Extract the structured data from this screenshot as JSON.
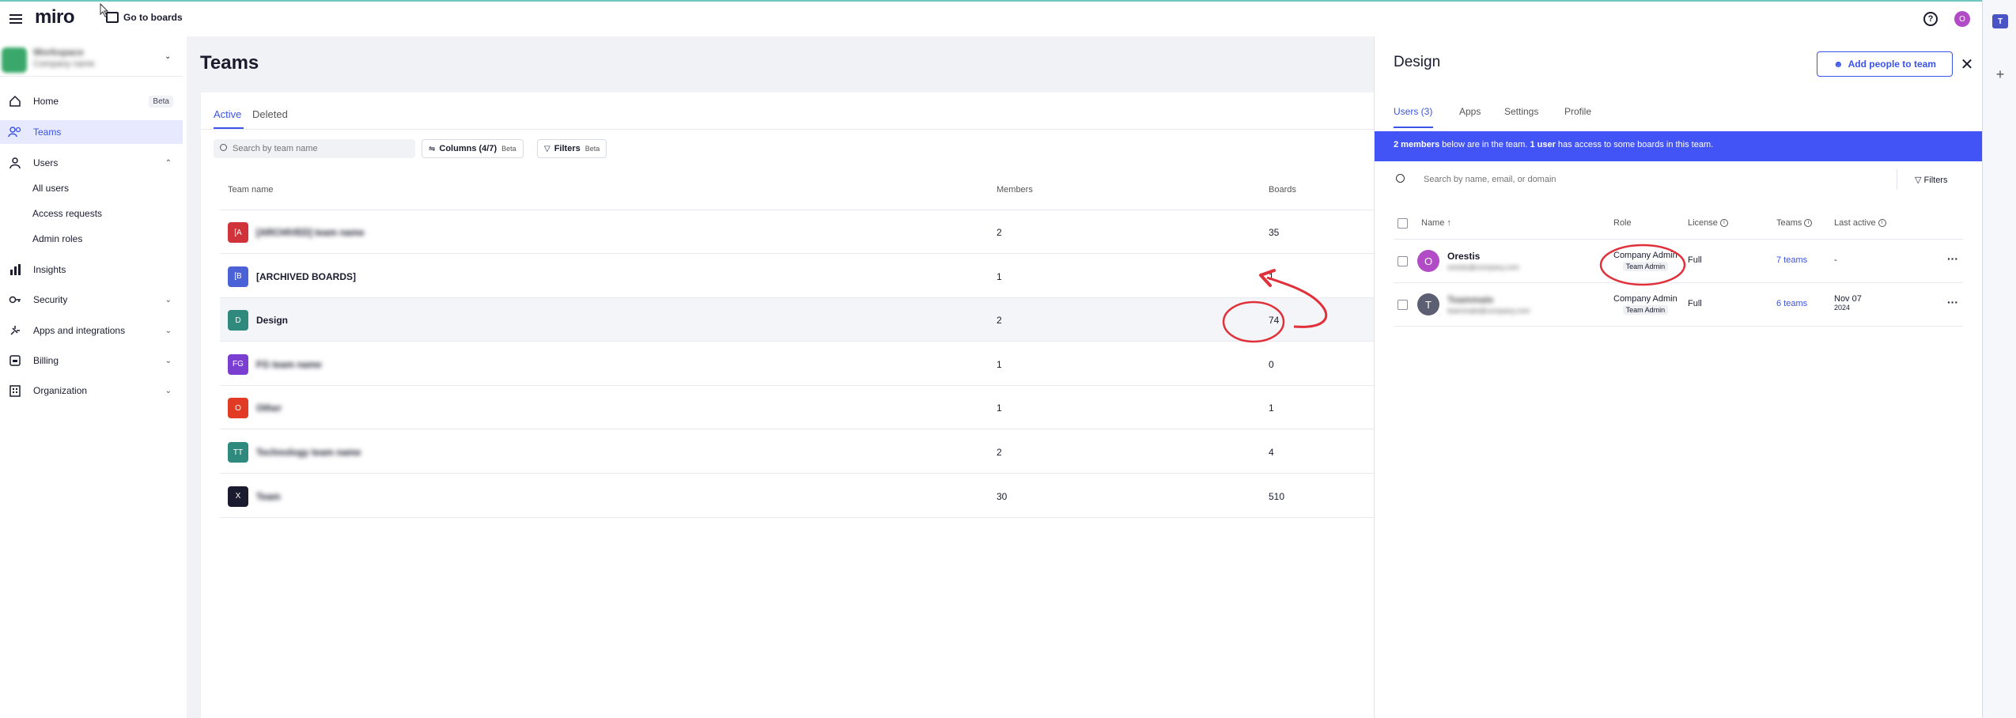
{
  "app": {
    "logo": "miro",
    "go_to_boards": "Go to boards",
    "user_initial": "O"
  },
  "sidebar": {
    "org_name": "Workspace",
    "org_sub": "Company name",
    "items": [
      {
        "label": "Home",
        "badge": "Beta"
      },
      {
        "label": "Teams"
      },
      {
        "label": "Users"
      },
      {
        "label": "Insights"
      },
      {
        "label": "Security"
      },
      {
        "label": "Apps and integrations"
      },
      {
        "label": "Billing"
      },
      {
        "label": "Organization"
      }
    ],
    "users_sub": [
      "All users",
      "Access requests",
      "Admin roles"
    ]
  },
  "main": {
    "title": "Teams",
    "tabs": [
      "Active",
      "Deleted"
    ],
    "search_placeholder": "Search by team name",
    "columns_label": "Columns (4/7)",
    "columns_badge": "Beta",
    "filters_label": "Filters",
    "filters_badge": "Beta",
    "headers": {
      "team": "Team name",
      "members": "Members",
      "boards": "Boards"
    },
    "rows": [
      {
        "initials": "[A",
        "name": "[ARCHIVED] team name",
        "members": "2",
        "boards": "35",
        "color": "#d0333a",
        "blurred": true
      },
      {
        "initials": "[B",
        "name": "[ARCHIVED BOARDS]",
        "members": "1",
        "boards": "1",
        "color": "#4b62d6",
        "blurred": false
      },
      {
        "initials": "D",
        "name": "Design",
        "members": "2",
        "boards": "74",
        "color": "#2f8a7d",
        "blurred": false
      },
      {
        "initials": "FG",
        "name": "FG team name",
        "members": "1",
        "boards": "0",
        "color": "#7a3fd1",
        "blurred": true
      },
      {
        "initials": "O",
        "name": "Other",
        "members": "1",
        "boards": "1",
        "color": "#e13a25",
        "blurred": true
      },
      {
        "initials": "TT",
        "name": "Technology team name",
        "members": "2",
        "boards": "4",
        "color": "#2f8a7d",
        "blurred": true
      },
      {
        "initials": "X",
        "name": "Team",
        "members": "30",
        "boards": "510",
        "color": "#1a1b2e",
        "blurred": true
      }
    ]
  },
  "panel": {
    "title": "Design",
    "add_people": "Add people to team",
    "tabs": [
      "Users (3)",
      "Apps",
      "Settings",
      "Profile"
    ],
    "banner_bold1": "2 members",
    "banner_mid": " below are in the team. ",
    "banner_bold2": "1 user",
    "banner_end": " has access to some boards in this team.",
    "search_placeholder": "Search by name, email, or domain",
    "filters_label": "Filters",
    "headers": {
      "name": "Name ↑",
      "role": "Role",
      "license": "License",
      "teams": "Teams",
      "last_active": "Last active"
    },
    "users": [
      {
        "initial": "O",
        "name": "Orestis",
        "email": "orestis@company.com",
        "role": "Company Admin",
        "tag": "Team Admin",
        "license": "Full",
        "teams": "7 teams",
        "last_active": "-",
        "last_active_year": "",
        "color": "#b14bc6"
      },
      {
        "initial": "T",
        "name": "Teammate",
        "email": "teammate@company.com",
        "role": "Company Admin",
        "tag": "Team Admin",
        "license": "Full",
        "teams": "6 teams",
        "last_active": "Nov 07",
        "last_active_year": "2024",
        "color": "#5c5f72"
      }
    ]
  },
  "colors": {
    "accent": "#3b53e6",
    "annotation": "#e0303a",
    "banner": "#4254f5"
  }
}
